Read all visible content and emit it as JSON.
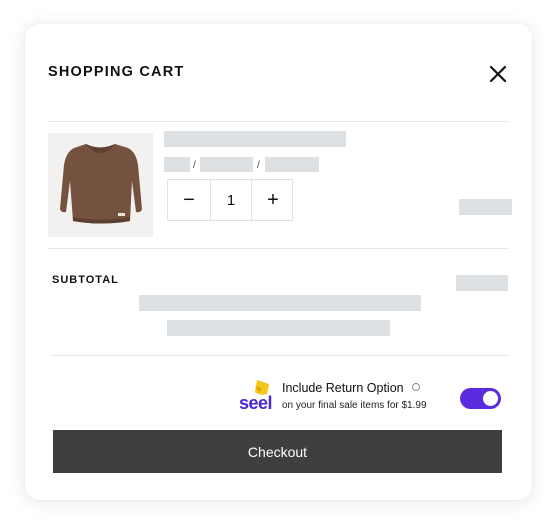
{
  "cart": {
    "title": "SHOPPING CART",
    "close_icon": "close-icon",
    "item": {
      "image": "brown-sweater-thumbnail",
      "variant_separator_1": "/",
      "variant_separator_2": "/",
      "quantity": {
        "minus_label": "−",
        "value": "1",
        "plus_label": "+"
      }
    },
    "subtotal_label": "SUBTOTAL",
    "return_option": {
      "logo_text": "seel",
      "title": "Include Return Option",
      "subtitle": "on your final sale items for $1.99",
      "enabled": true,
      "toggle_color": "#5b2be0",
      "logo_color": "#4b2bd1",
      "logo_accent_color": "#f5c518"
    },
    "checkout_label": "Checkout"
  }
}
